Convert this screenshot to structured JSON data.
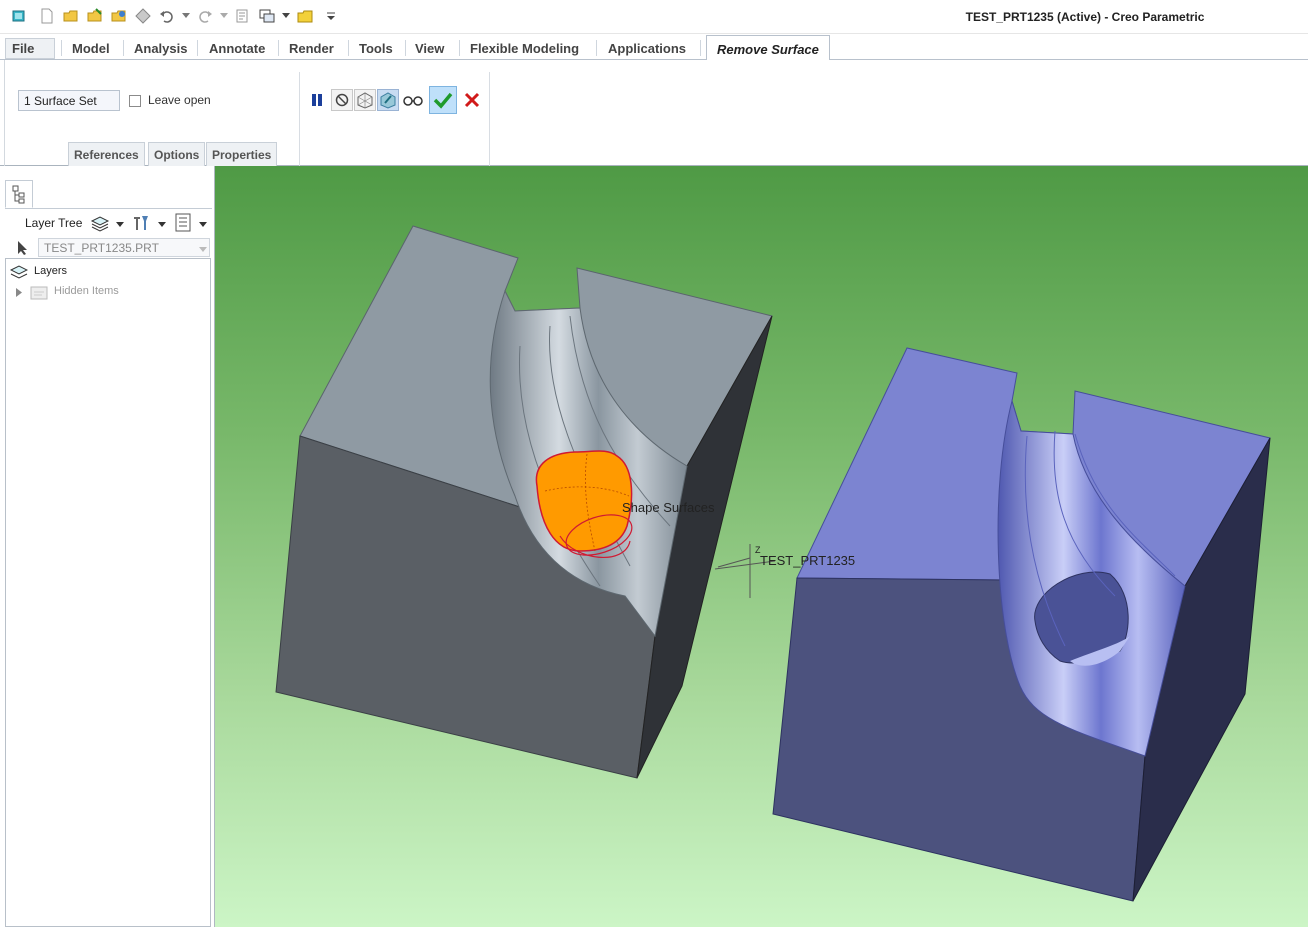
{
  "window": {
    "title": "TEST_PRT1235 (Active) - Creo Parametric"
  },
  "quick_access": [
    {
      "name": "regenerate-icon"
    },
    {
      "name": "new-icon"
    },
    {
      "name": "open-icon"
    },
    {
      "name": "save-icon"
    },
    {
      "name": "save-as-icon"
    },
    {
      "name": "print-icon"
    },
    {
      "name": "undo-icon"
    },
    {
      "name": "redo-icon"
    },
    {
      "name": "regenerate-model-icon"
    },
    {
      "name": "windows-icon"
    },
    {
      "name": "close-window-icon"
    },
    {
      "name": "customize-icon"
    }
  ],
  "ribbon": {
    "file_label": "File",
    "tabs": [
      "Model",
      "Analysis",
      "Annotate",
      "Render",
      "Tools",
      "View",
      "Flexible Modeling",
      "Applications"
    ],
    "active_tab": "Remove Surface"
  },
  "dashboard": {
    "surface_set": "1 Surface Set",
    "leave_open": {
      "label": "Leave open",
      "checked": false
    },
    "subtabs": [
      "References",
      "Options",
      "Properties"
    ],
    "buttons": [
      "pause-icon",
      "no-preview-icon",
      "preview-geometry-icon",
      "verify-icon",
      "glasses-icon",
      "apply-check-icon",
      "cancel-x-icon"
    ],
    "colors": {
      "pause": "#1c3f9b",
      "check": "#1f9a2c",
      "cancel": "#d11a1a"
    }
  },
  "left_panel": {
    "header": "Layer Tree",
    "model": "TEST_PRT1235.PRT",
    "tree": {
      "root": "Layers",
      "child": "Hidden Items"
    }
  },
  "viewport": {
    "tooltip": "Shape Surfaces",
    "csys_label": "TEST_PRT1235",
    "csys_axis": "Z",
    "colors": {
      "block_left": "#8f9aa3",
      "block_right": "#7c84d1",
      "selection": "#ff9a00",
      "highlight_edge": "#d01a32"
    }
  }
}
